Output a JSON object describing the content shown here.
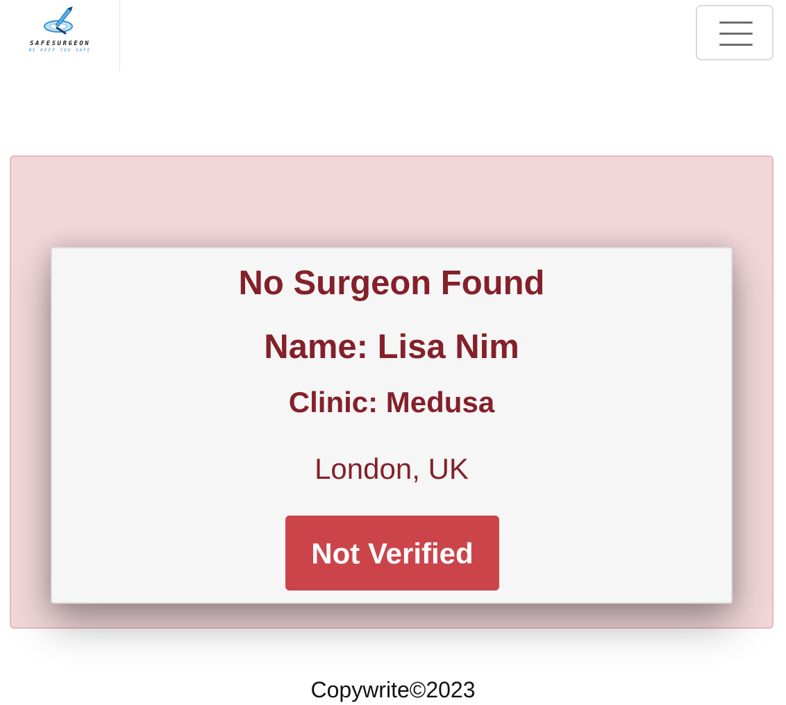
{
  "navbar": {
    "logo": {
      "title": "SAFESURGEON",
      "tagline": "WE KEEP YOU SAFE"
    },
    "menu_icon": "hamburger-menu-icon"
  },
  "result": {
    "title": "No Surgeon Found",
    "name": "Name: Lisa Nim",
    "clinic": "Clinic: Medusa",
    "location": "London, UK",
    "status_label": "Not Verified"
  },
  "footer": {
    "text": "Copywrite©2023"
  },
  "colors": {
    "panel_background": "#f2d7da",
    "panel_border": "#e8b7bd",
    "text_accent": "#842029",
    "status_button": "#cb444a"
  }
}
